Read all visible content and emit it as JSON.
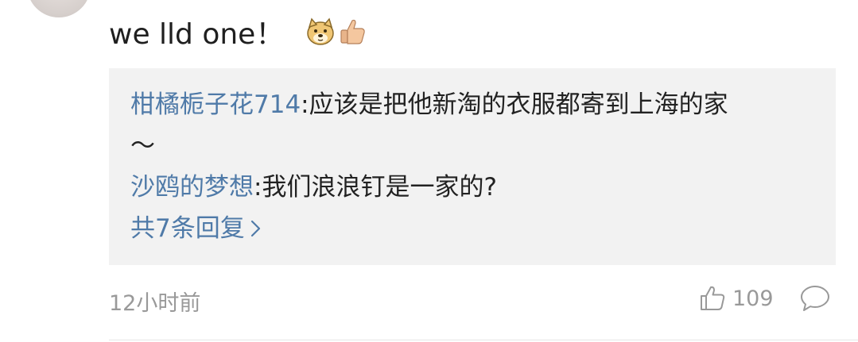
{
  "comment": {
    "text": "we lld one！",
    "emojis": [
      "doge-face-icon",
      "thumbs-up-icon"
    ]
  },
  "replies": [
    {
      "user": "柑橘栀子花714",
      "separator": ":",
      "text": "应该是把他新淘的衣服都寄到上海的家",
      "continuation": "～"
    },
    {
      "user": "沙鸥的梦想",
      "separator": ":",
      "text": "我们浪浪钉是一家的?"
    }
  ],
  "more_replies": {
    "label": "共7条回复",
    "icon": "chevron-right-icon"
  },
  "footer": {
    "timestamp": "12小时前",
    "like_count": "109",
    "like_icon": "thumbs-up-outline-icon",
    "comment_icon": "comment-bubble-icon"
  },
  "colors": {
    "link_blue": "#4f7aa8",
    "meta_gray": "#999999",
    "reply_bg": "#f2f2f2",
    "text": "#222222"
  }
}
